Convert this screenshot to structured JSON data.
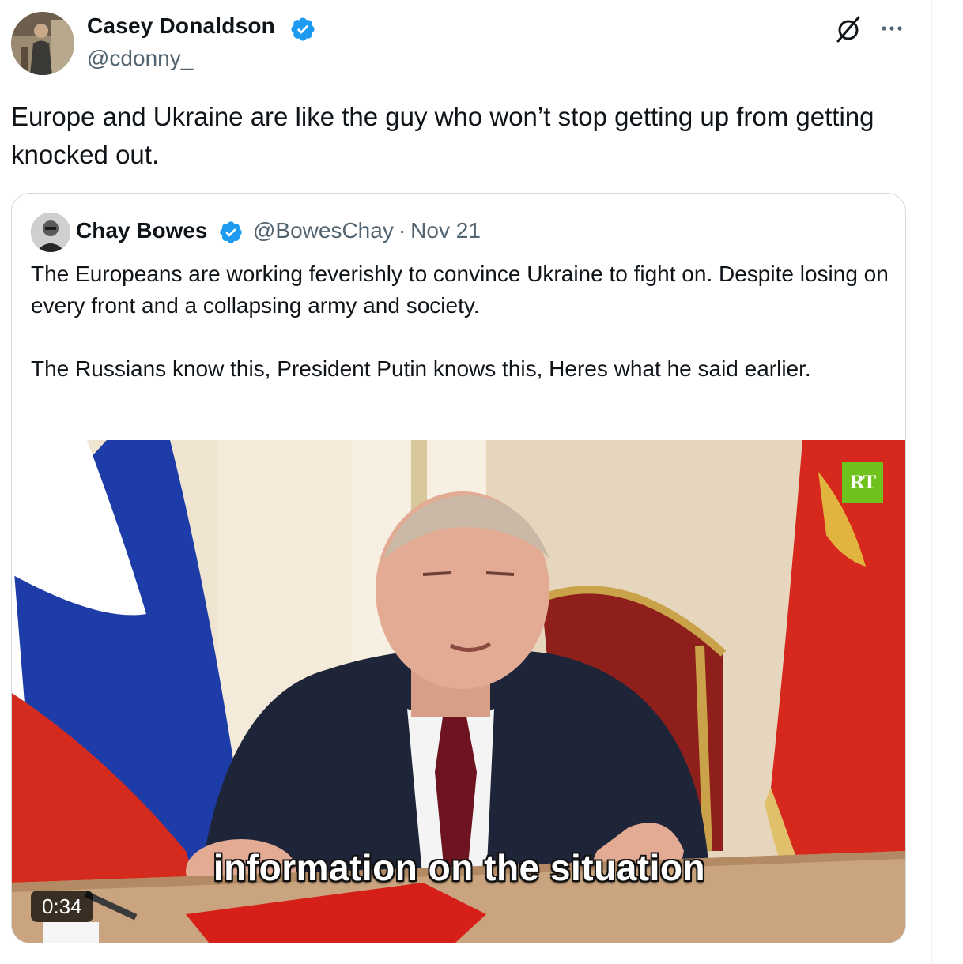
{
  "tweet": {
    "author": {
      "name": "Casey Donaldson",
      "handle": "@cdonny_",
      "verified": true
    },
    "text": "Europe and Ukraine are like the guy who won’t stop getting up from getting knocked out.",
    "icons": {
      "grok": "grok-slash-icon",
      "more": "more-dots-icon"
    }
  },
  "quote": {
    "author": {
      "name": "Chay Bowes",
      "handle": "@BowesChay",
      "separator": "·",
      "date": "Nov 21",
      "verified": true
    },
    "paragraphs": [
      "The Europeans are working feverishly to convince Ukraine to fight on. Despite losing on every front and a collapsing army and society.",
      "The Russians know this,  President Putin knows this, Heres what he said earlier."
    ],
    "video": {
      "caption": "information on the situation",
      "duration": "0:34",
      "watermark": "RT"
    }
  },
  "colors": {
    "verified": "#1d9bf0",
    "border": "#cfd9de",
    "secondary_text": "#536471",
    "text": "#0f1419"
  }
}
